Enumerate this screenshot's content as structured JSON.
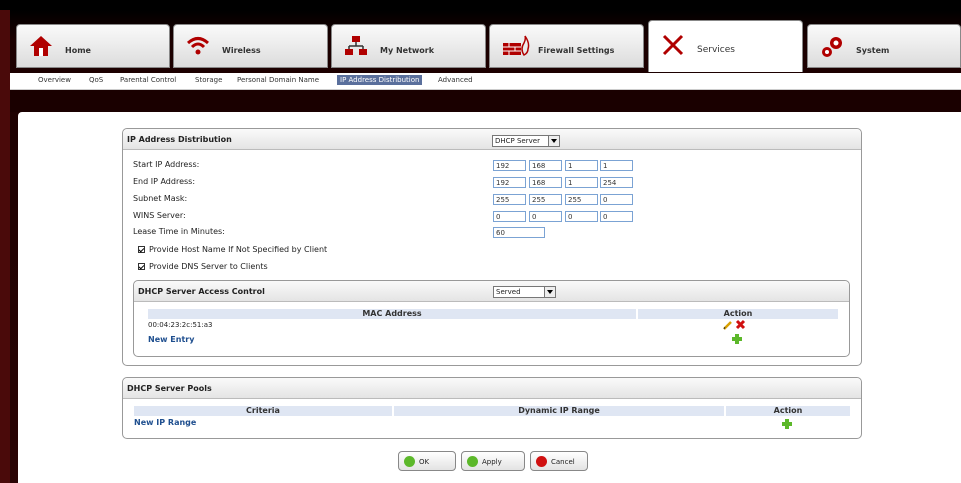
{
  "tabs": [
    {
      "label": "Home",
      "icon": "home-icon"
    },
    {
      "label": "Wireless",
      "icon": "wireless-icon"
    },
    {
      "label": "My Network",
      "icon": "network-icon"
    },
    {
      "label": "Firewall Settings",
      "icon": "firewall-icon"
    },
    {
      "label": "Services",
      "icon": "services-icon",
      "active": true
    },
    {
      "label": "System",
      "icon": "gears-icon"
    }
  ],
  "subnav": [
    "Overview",
    "QoS",
    "Parental Control",
    "Storage",
    "Personal Domain Name",
    "IP Address Distribution",
    "Advanced"
  ],
  "ipdist": {
    "title": "IP Address Distribution",
    "mode": "DHCP Server",
    "start_label": "Start IP Address:",
    "start": [
      "192",
      "168",
      "1",
      "1"
    ],
    "end_label": "End IP Address:",
    "end": [
      "192",
      "168",
      "1",
      "254"
    ],
    "mask_label": "Subnet Mask:",
    "mask": [
      "255",
      "255",
      "255",
      "0"
    ],
    "wins_label": "WINS Server:",
    "wins": [
      "0",
      "0",
      "0",
      "0"
    ],
    "lease_label": "Lease Time in Minutes:",
    "lease": "60",
    "cb_hostname": "Provide Host Name If Not Specified by Client",
    "cb_dns": "Provide DNS Server to Clients"
  },
  "access": {
    "title": "DHCP Server Access Control",
    "mode": "Served",
    "col_mac": "MAC Address",
    "col_action": "Action",
    "mac": "00:04:23:2c:51:a3",
    "new_entry": "New Entry"
  },
  "pools": {
    "title": "DHCP Server Pools",
    "col_criteria": "Criteria",
    "col_range": "Dynamic IP Range",
    "col_action": "Action",
    "new_range": "New IP Range"
  },
  "buttons": {
    "ok": "OK",
    "apply": "Apply",
    "cancel": "Cancel"
  }
}
